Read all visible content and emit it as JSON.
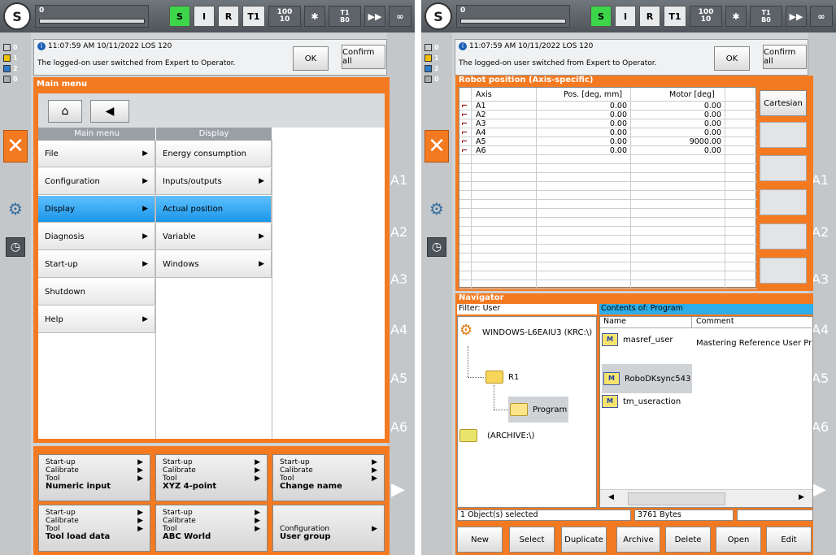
{
  "topbar": {
    "program_number": "0",
    "s": "S",
    "i": "I",
    "r": "R",
    "t1": "T1",
    "override_top": "100",
    "override_bottom": "10",
    "tool_top": "T1",
    "tool_bottom": "B0",
    "infinity": "∞"
  },
  "indicators": [
    "0",
    "1",
    "2",
    "0"
  ],
  "message": {
    "time": "11:07:59 AM 10/11/2022 LOS 120",
    "text": "The logged-on user switched from Expert to Operator.",
    "ok": "OK",
    "confirm_all": "Confirm all"
  },
  "axis_labels": [
    "A1",
    "A2",
    "A3",
    "A4",
    "A5",
    "A6"
  ],
  "main_menu": {
    "title": "Main menu",
    "col1_header": "Main menu",
    "col2_header": "Display",
    "col1": [
      {
        "label": "File",
        "arrow": true
      },
      {
        "label": "Configuration",
        "arrow": true
      },
      {
        "label": "Display",
        "arrow": true,
        "selected": true
      },
      {
        "label": "Diagnosis",
        "arrow": true
      },
      {
        "label": "Start-up",
        "arrow": true
      },
      {
        "label": "Shutdown",
        "arrow": false
      },
      {
        "label": "Help",
        "arrow": true
      }
    ],
    "col2": [
      {
        "label": "Energy consumption",
        "arrow": false
      },
      {
        "label": "Inputs/outputs",
        "arrow": true
      },
      {
        "label": "Actual position",
        "arrow": false,
        "selected": true
      },
      {
        "label": "Variable",
        "arrow": true
      },
      {
        "label": "Windows",
        "arrow": true
      }
    ]
  },
  "shortcuts": [
    {
      "lines": [
        "Start-up",
        "Calibrate",
        "Tool"
      ],
      "title": "Numeric input"
    },
    {
      "lines": [
        "Start-up",
        "Calibrate",
        "Tool"
      ],
      "title": "XYZ 4-point"
    },
    {
      "lines": [
        "Start-up",
        "Calibrate",
        "Tool"
      ],
      "title": "Change name"
    },
    {
      "lines": [
        "Start-up",
        "Calibrate",
        "Tool"
      ],
      "title": "Tool load data"
    },
    {
      "lines": [
        "Start-up",
        "Calibrate",
        "Tool"
      ],
      "title": "ABC World"
    },
    {
      "lines": [
        "Configuration"
      ],
      "title": "User group"
    }
  ],
  "robot_position": {
    "title": "Robot position (Axis-specific)",
    "col_axis": "Axis",
    "col_pos": "Pos. [deg, mm]",
    "col_motor": "Motor [deg]",
    "cartesian": "Cartesian",
    "rows": [
      {
        "axis": "A1",
        "pos": "0.00",
        "motor": "0.00"
      },
      {
        "axis": "A2",
        "pos": "0.00",
        "motor": "0.00"
      },
      {
        "axis": "A3",
        "pos": "0.00",
        "motor": "0.00"
      },
      {
        "axis": "A4",
        "pos": "0.00",
        "motor": "0.00"
      },
      {
        "axis": "A5",
        "pos": "0.00",
        "motor": "9000.00"
      },
      {
        "axis": "A6",
        "pos": "0.00",
        "motor": "0.00"
      }
    ]
  },
  "navigator": {
    "title": "Navigator",
    "filter": "Filter: User",
    "contents_of": "Contents of: Program",
    "col_name": "Name",
    "col_comment": "Comment",
    "tree": {
      "root": "WINDOWS-L6EAIU3 (KRC:\\)",
      "r1": "R1",
      "program": "Program",
      "archive": "(ARCHIVE:\\)"
    },
    "files": [
      {
        "name": "masref_user",
        "comment": "Mastering Reference User Pro"
      },
      {
        "name": "RoboDKsync543",
        "comment": ""
      },
      {
        "name": "tm_useraction",
        "comment": ""
      }
    ],
    "status_selected": "1 Object(s) selected",
    "status_size": "3761 Bytes",
    "buttons": [
      "New",
      "Select",
      "Duplicate",
      "Archive",
      "Delete",
      "Open",
      "Edit"
    ]
  }
}
